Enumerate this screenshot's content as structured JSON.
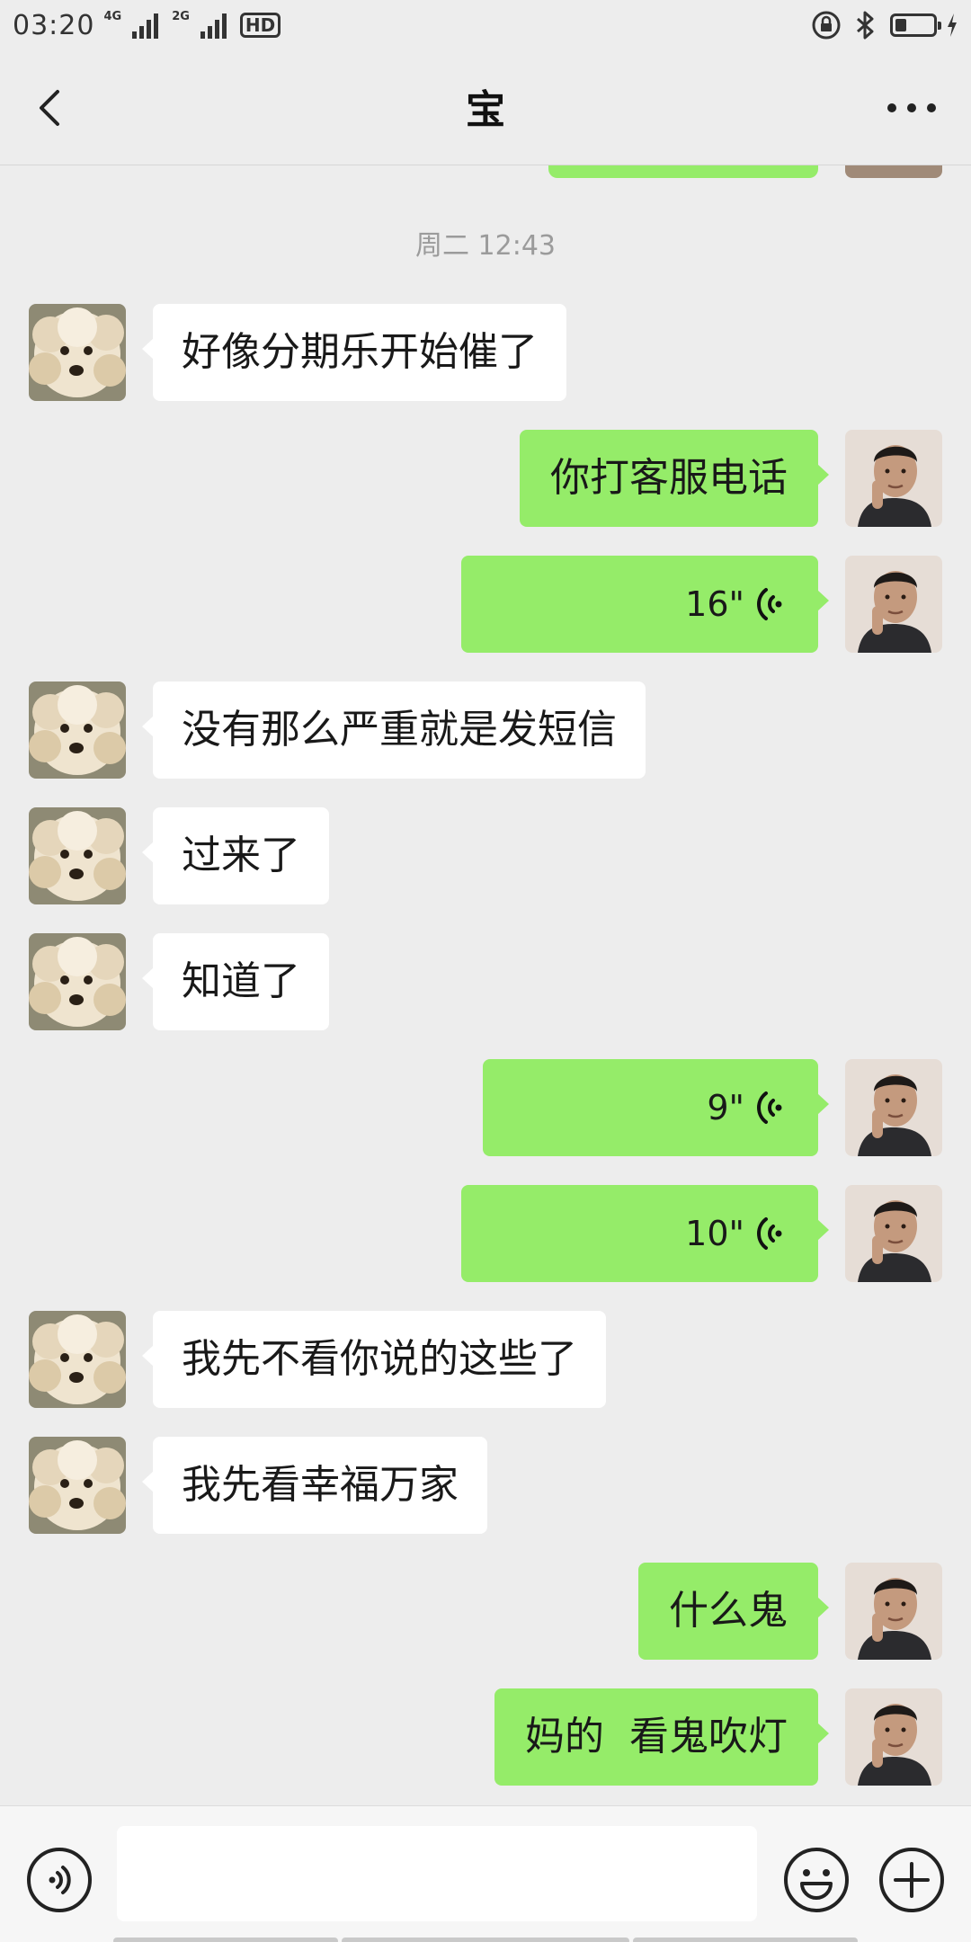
{
  "status_bar": {
    "time": "03:20",
    "net1": "4G",
    "net2": "2G",
    "hd": "HD",
    "battery_level": 0.25,
    "icons": [
      "signal-icon",
      "signal-icon",
      "lock-rotation-icon",
      "bluetooth-icon",
      "battery-icon",
      "charging-icon"
    ]
  },
  "nav": {
    "title": "宝",
    "back_icon": "chevron-left-icon",
    "more_icon": "more-dots-icon"
  },
  "chat": {
    "timestamp": "周二 12:43",
    "messages": [
      {
        "side": "left",
        "type": "text",
        "text": "好像分期乐开始催了"
      },
      {
        "side": "right",
        "type": "text",
        "text": "你打客服电话"
      },
      {
        "side": "right",
        "type": "voice",
        "duration": "16\""
      },
      {
        "side": "left",
        "type": "text",
        "text": "没有那么严重就是发短信"
      },
      {
        "side": "left",
        "type": "text",
        "text": "过来了"
      },
      {
        "side": "left",
        "type": "text",
        "text": "知道了"
      },
      {
        "side": "right",
        "type": "voice",
        "duration": "9\""
      },
      {
        "side": "right",
        "type": "voice",
        "duration": "10\""
      },
      {
        "side": "left",
        "type": "text",
        "text": "我先不看你说的这些了"
      },
      {
        "side": "left",
        "type": "text",
        "text": "我先看幸福万家"
      },
      {
        "side": "right",
        "type": "text",
        "text": "什么鬼"
      },
      {
        "side": "right",
        "type": "text",
        "text": "妈的  看鬼吹灯"
      }
    ]
  },
  "input_bar": {
    "voice_icon": "voice-input-icon",
    "emoji_icon": "emoji-icon",
    "plus_icon": "plus-icon"
  },
  "colors": {
    "bubble_mine": "#95ec69",
    "bubble_theirs": "#ffffff",
    "background": "#ededed"
  }
}
